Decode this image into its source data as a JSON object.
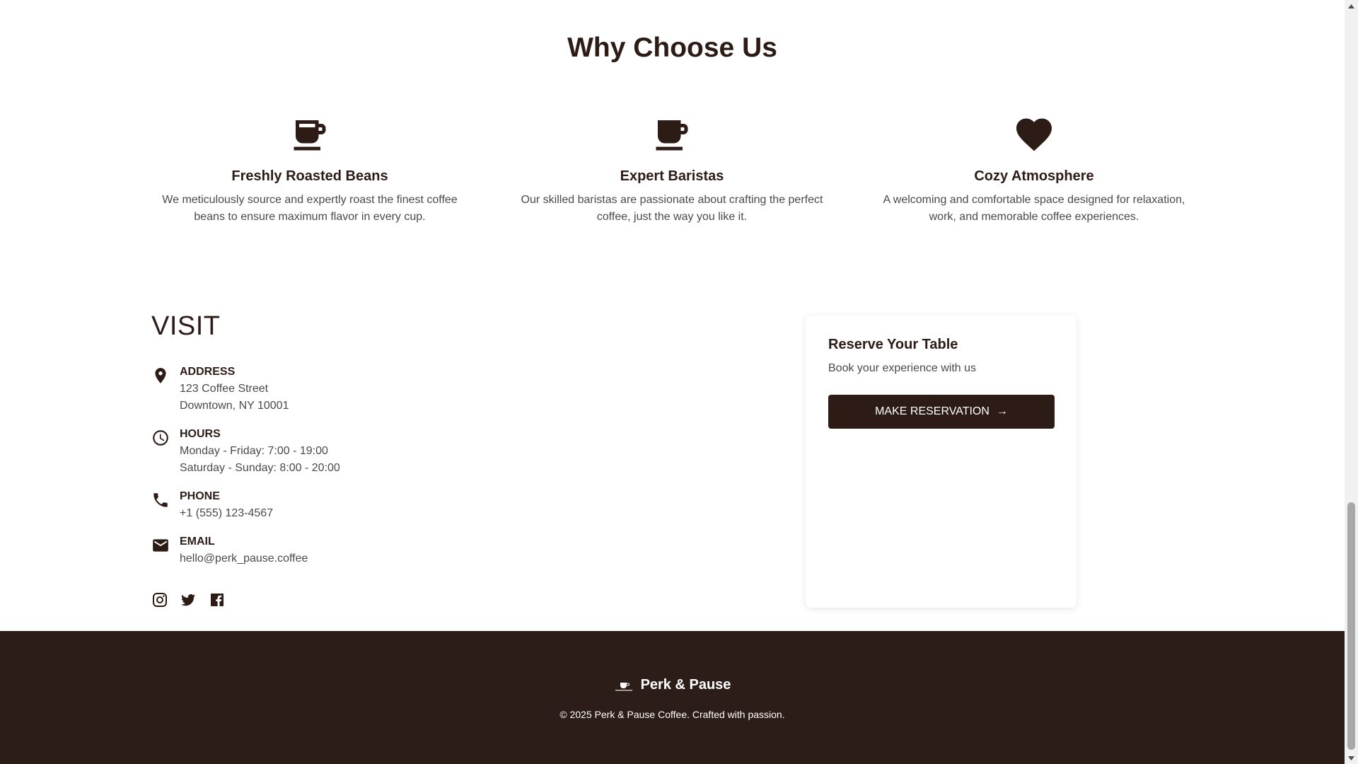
{
  "why_section": {
    "title": "Why Choose Us",
    "features": [
      {
        "icon": "coffee-cup-icon",
        "title": "Freshly Roasted Beans",
        "description": "We meticulously source and expertly roast the finest coffee beans to ensure maximum flavor in every cup."
      },
      {
        "icon": "coffee-mug-icon",
        "title": "Expert Baristas",
        "description": "Our skilled baristas are passionate about crafting the perfect coffee, just the way you like it."
      },
      {
        "icon": "heart-icon",
        "title": "Cozy Atmosphere",
        "description": "A welcoming and comfortable space designed for relaxation, work, and memorable coffee experiences."
      }
    ]
  },
  "visit": {
    "title": "VISIT",
    "address": {
      "icon": "location-pin-icon",
      "label": "ADDRESS",
      "lines": [
        "123 Coffee Street",
        "Downtown, NY 10001"
      ]
    },
    "hours": {
      "icon": "clock-icon",
      "label": "HOURS",
      "lines": [
        "Monday - Friday: 7:00 - 19:00",
        "Saturday - Sunday: 8:00 - 20:00"
      ]
    },
    "phone": {
      "icon": "phone-icon",
      "label": "PHONE",
      "lines": [
        "+1 (555) 123-4567"
      ]
    },
    "email": {
      "icon": "mail-icon",
      "label": "EMAIL",
      "lines": [
        "hello@perk_pause.coffee"
      ]
    },
    "socials": [
      "instagram-icon",
      "twitter-icon",
      "facebook-icon"
    ]
  },
  "reservation": {
    "title": "Reserve Your Table",
    "subtitle": "Book your experience with us",
    "button_label": "MAKE RESERVATION",
    "button_arrow": "→"
  },
  "footer": {
    "brand_name": "Perk & Pause",
    "copyright": "© 2025 Perk & Pause Coffee. Crafted with passion."
  },
  "colors": {
    "brand_dark": "#2d1b16",
    "footer_bg": "#2d1d18",
    "body_text": "#4a4a4a"
  }
}
